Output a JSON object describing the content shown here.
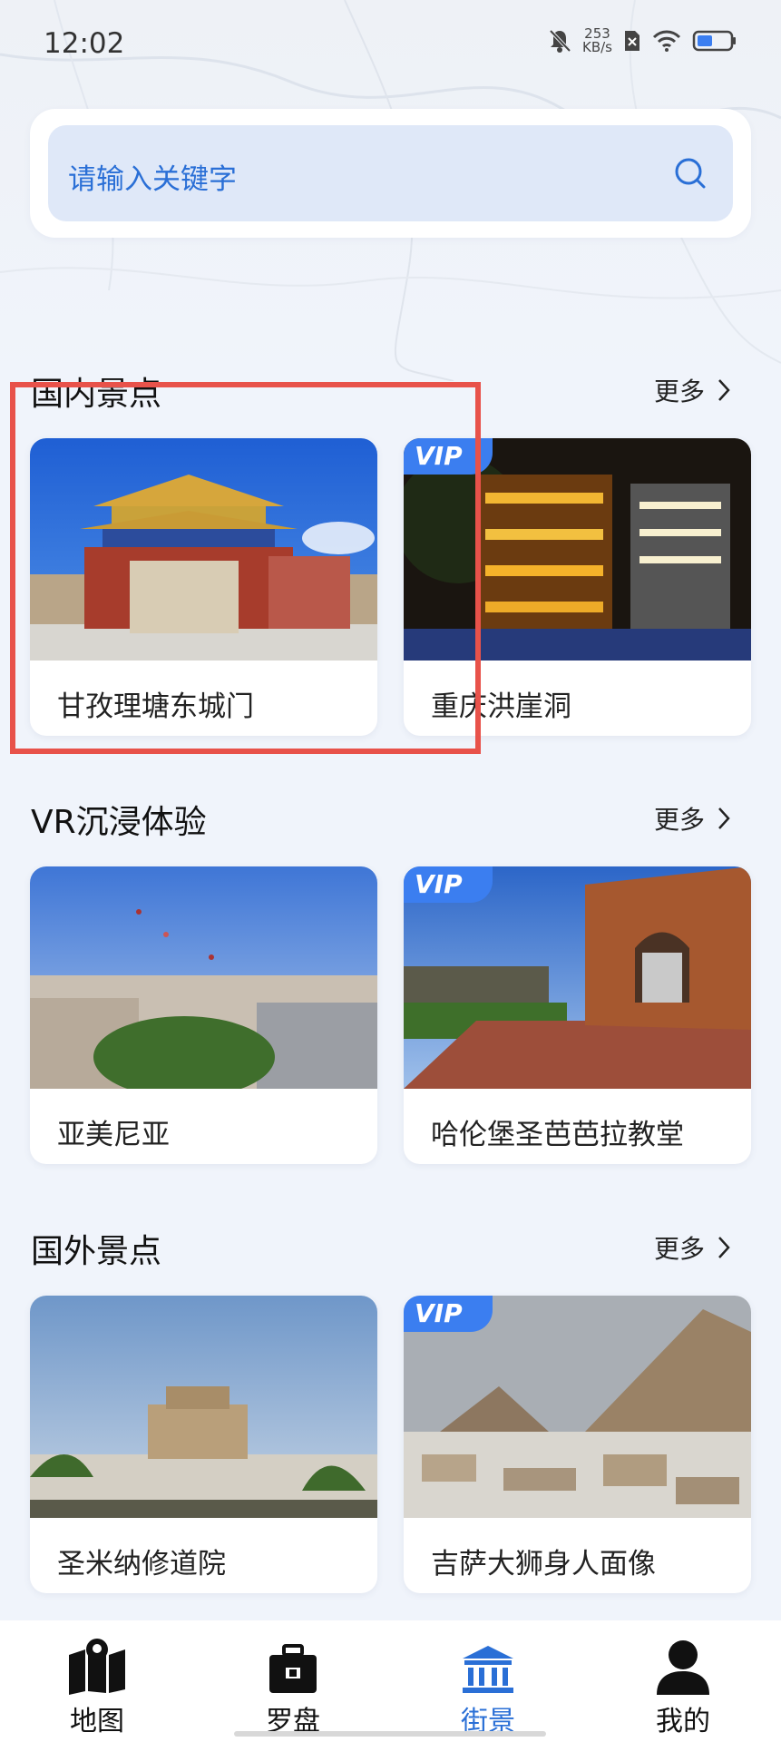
{
  "status": {
    "time": "12:02",
    "speed_value": "253",
    "speed_unit": "KB/s"
  },
  "search": {
    "placeholder": "请输入关键字",
    "icon": "search-icon"
  },
  "sections": [
    {
      "title": "国内景点",
      "more": "更多",
      "cards": [
        {
          "name": "甘孜理塘东城门",
          "vip": false
        },
        {
          "name": "重庆洪崖洞",
          "vip": true
        }
      ]
    },
    {
      "title": "VR沉浸体验",
      "more": "更多",
      "cards": [
        {
          "name": "亚美尼亚",
          "vip": false
        },
        {
          "name": "哈伦堡圣芭芭拉教堂",
          "vip": true
        }
      ]
    },
    {
      "title": "国外景点",
      "more": "更多",
      "cards": [
        {
          "name": "圣米纳修道院",
          "vip": false
        },
        {
          "name": "吉萨大狮身人面像",
          "vip": true
        }
      ]
    }
  ],
  "vip_label": "VIP",
  "nav": [
    {
      "label": "地图",
      "icon": "map-icon",
      "active": false
    },
    {
      "label": "罗盘",
      "icon": "compass-box-icon",
      "active": false
    },
    {
      "label": "街景",
      "icon": "museum-icon",
      "active": true
    },
    {
      "label": "我的",
      "icon": "user-icon",
      "active": false
    }
  ],
  "colors": {
    "accent": "#2a6fd6",
    "vip": "#3b7ef0",
    "highlight": "#e8524a",
    "background": "#f0f4fb"
  }
}
